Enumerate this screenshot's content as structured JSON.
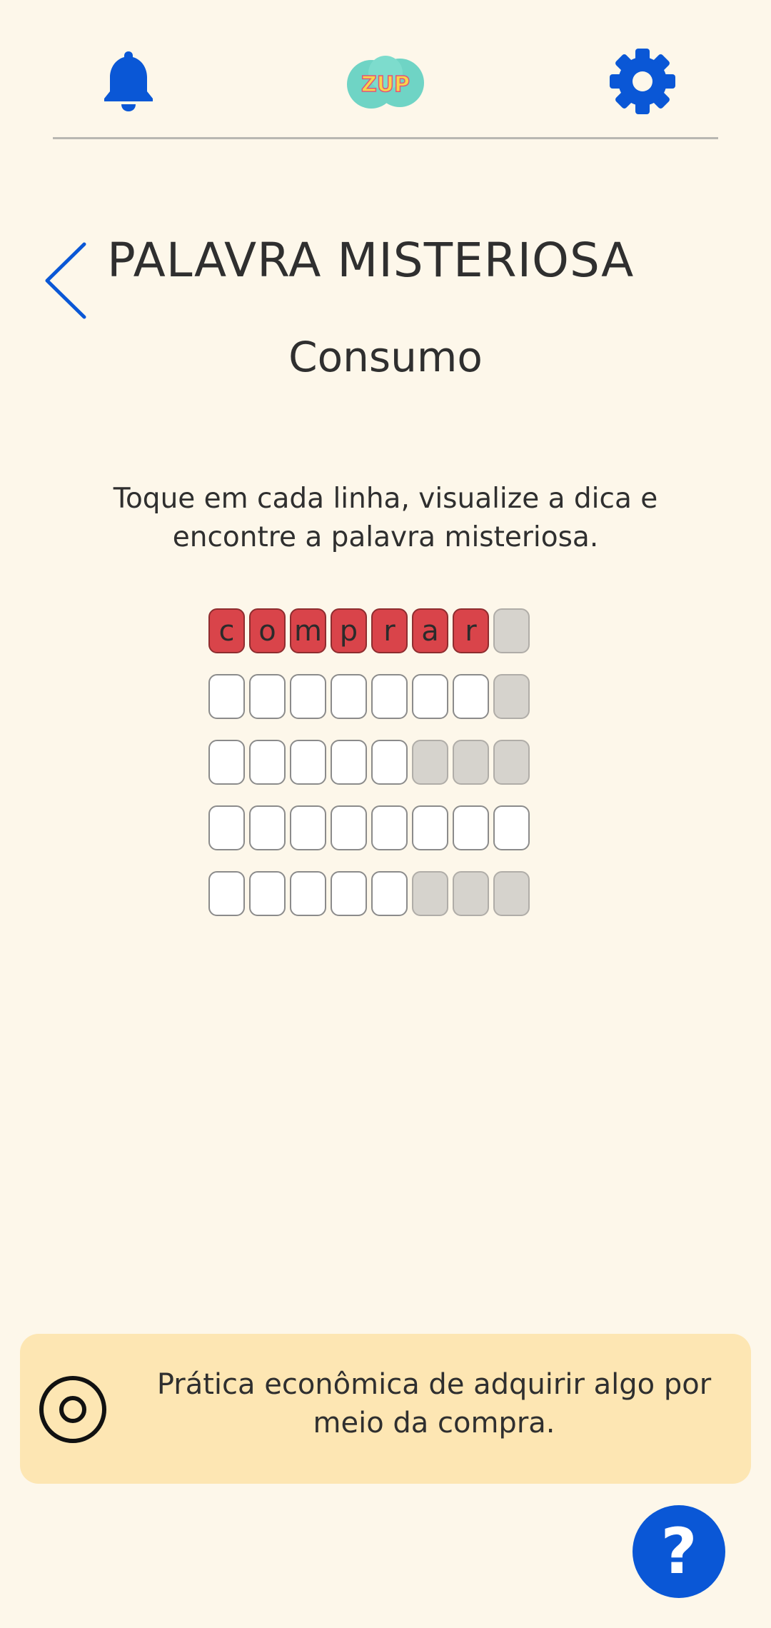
{
  "header": {
    "bell_icon": "bell-icon",
    "logo_text": "ZUP",
    "settings_icon": "gear-icon"
  },
  "page": {
    "back_icon": "chevron-left-icon",
    "title": "PALAVRA MISTERIOSA",
    "subtitle": "Consumo",
    "instructions": "Toque em cada linha, visualize a dica e encontre a palavra misteriosa."
  },
  "grid": {
    "rows": [
      {
        "cells": [
          {
            "letter": "c",
            "state": "red"
          },
          {
            "letter": "o",
            "state": "red"
          },
          {
            "letter": "m",
            "state": "red"
          },
          {
            "letter": "p",
            "state": "red"
          },
          {
            "letter": "r",
            "state": "red"
          },
          {
            "letter": "a",
            "state": "red"
          },
          {
            "letter": "r",
            "state": "red"
          },
          {
            "letter": "",
            "state": "gray"
          }
        ]
      },
      {
        "cells": [
          {
            "letter": "",
            "state": "empty"
          },
          {
            "letter": "",
            "state": "empty"
          },
          {
            "letter": "",
            "state": "empty"
          },
          {
            "letter": "",
            "state": "empty"
          },
          {
            "letter": "",
            "state": "empty"
          },
          {
            "letter": "",
            "state": "empty"
          },
          {
            "letter": "",
            "state": "empty"
          },
          {
            "letter": "",
            "state": "gray"
          }
        ]
      },
      {
        "cells": [
          {
            "letter": "",
            "state": "empty"
          },
          {
            "letter": "",
            "state": "empty"
          },
          {
            "letter": "",
            "state": "empty"
          },
          {
            "letter": "",
            "state": "empty"
          },
          {
            "letter": "",
            "state": "empty"
          },
          {
            "letter": "",
            "state": "gray"
          },
          {
            "letter": "",
            "state": "gray"
          },
          {
            "letter": "",
            "state": "gray"
          }
        ]
      },
      {
        "cells": [
          {
            "letter": "",
            "state": "empty"
          },
          {
            "letter": "",
            "state": "empty"
          },
          {
            "letter": "",
            "state": "empty"
          },
          {
            "letter": "",
            "state": "empty"
          },
          {
            "letter": "",
            "state": "empty"
          },
          {
            "letter": "",
            "state": "empty"
          },
          {
            "letter": "",
            "state": "empty"
          },
          {
            "letter": "",
            "state": "empty"
          }
        ]
      },
      {
        "cells": [
          {
            "letter": "",
            "state": "empty"
          },
          {
            "letter": "",
            "state": "empty"
          },
          {
            "letter": "",
            "state": "empty"
          },
          {
            "letter": "",
            "state": "empty"
          },
          {
            "letter": "",
            "state": "empty"
          },
          {
            "letter": "",
            "state": "gray"
          },
          {
            "letter": "",
            "state": "gray"
          },
          {
            "letter": "",
            "state": "gray"
          }
        ]
      }
    ]
  },
  "hint": {
    "icon": "target-icon",
    "text": "Prática econômica de adquirir algo por meio da compra."
  },
  "help": {
    "label": "?",
    "icon": "question-icon"
  },
  "colors": {
    "background": "#fdf7ea",
    "accent_blue": "#0a57d6",
    "cell_red": "#d9444a",
    "cell_gray": "#d6d3cd",
    "hint_background": "#fde6b3"
  }
}
